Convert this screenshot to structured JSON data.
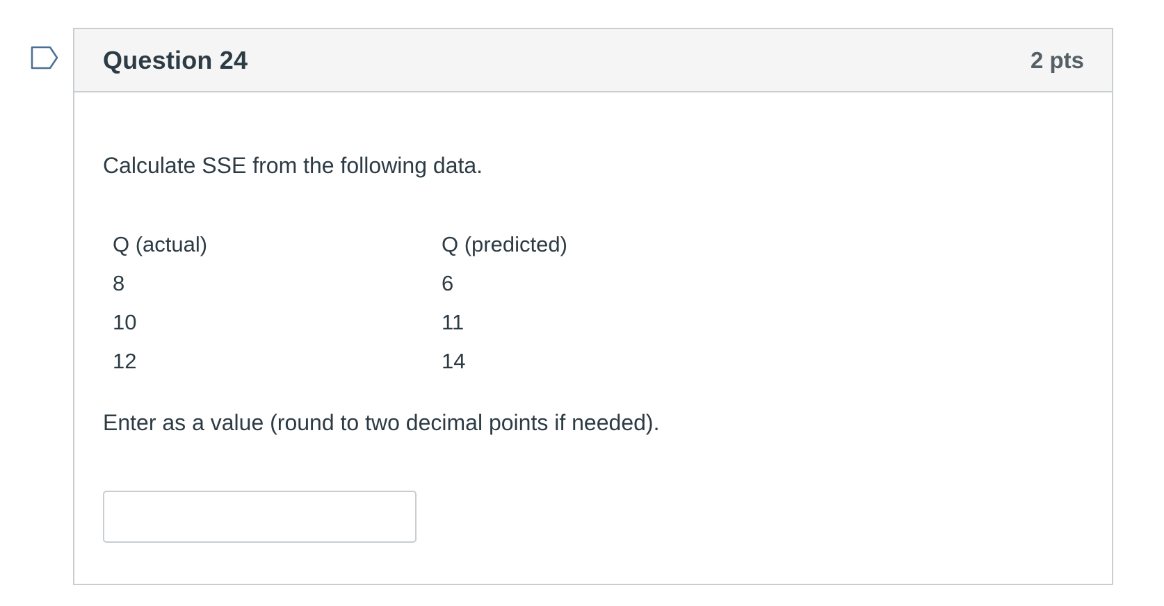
{
  "question": {
    "title": "Question 24",
    "points": "2 pts",
    "prompt": "Calculate SSE from the following data.",
    "table": {
      "headers": [
        "Q (actual)",
        "Q (predicted)"
      ],
      "rows": [
        [
          "8",
          "6"
        ],
        [
          "10",
          "11"
        ],
        [
          "12",
          "14"
        ]
      ]
    },
    "instruction": "Enter as a value (round to two decimal points if needed).",
    "answer_value": "",
    "answer_placeholder": ""
  },
  "icons": {
    "flag": "flag-question-icon"
  },
  "colors": {
    "text": "#2d3b45",
    "border": "#c7cdd1",
    "header_bg": "#f5f5f5",
    "flag": "#4a6f94"
  }
}
